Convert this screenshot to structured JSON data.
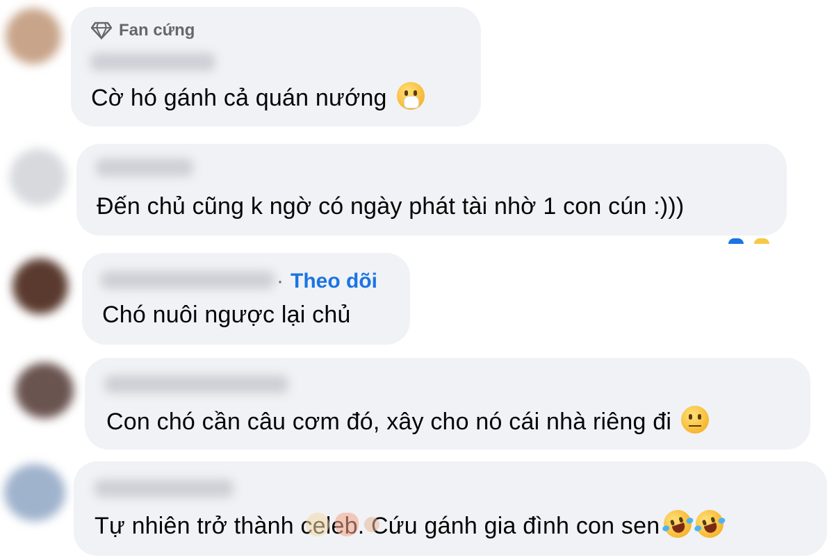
{
  "comments": [
    {
      "badge_label": "Fan cứng",
      "badge_icon": "diamond-icon",
      "text": "Cờ hó gánh cả quán nướng",
      "emoji": [
        "face-with-hand-over-mouth-icon"
      ]
    },
    {
      "text": "Đến chủ cũng k ngờ có ngày phát tài nhờ 1 con cún :)))"
    },
    {
      "follow_label": "Theo dõi",
      "text": "Chó nuôi ngược lại chủ"
    },
    {
      "text": "Con chó cần câu cơm đó, xây cho nó cái nhà riêng đi",
      "emoji": [
        "face-with-raised-eyebrow-icon"
      ]
    },
    {
      "text": "Tự nhiên trở thành celeb. Cứu gánh gia đình con sen",
      "emoji": [
        "rolling-on-floor-laughing-icon",
        "rolling-on-floor-laughing-icon"
      ]
    }
  ],
  "colors": {
    "bubble": "#f0f2f5",
    "text": "#050505",
    "follow": "#1b74e4",
    "muted": "#65676b"
  }
}
